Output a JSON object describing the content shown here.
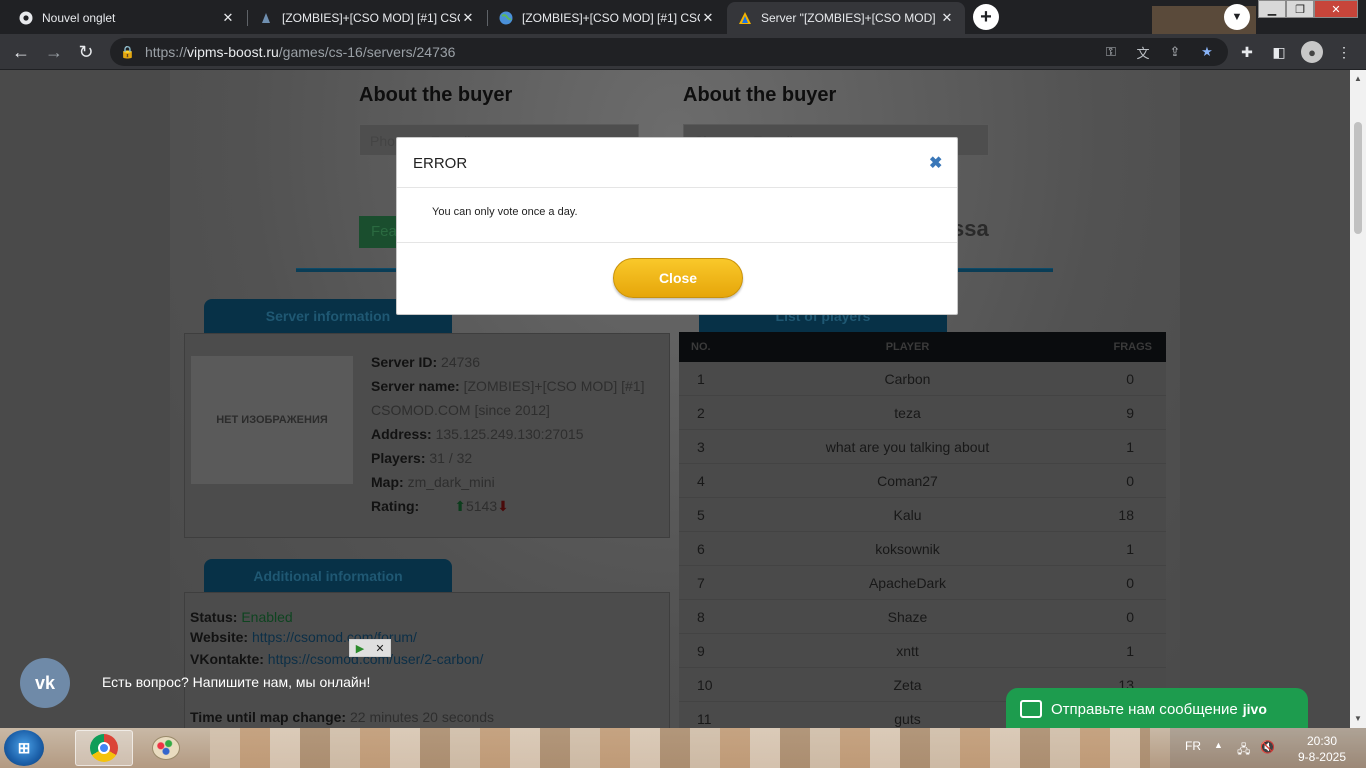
{
  "browser": {
    "tabs": [
      {
        "title": "Nouvel onglet",
        "icon": "chrome-icon",
        "active": false
      },
      {
        "title": "[ZOMBIES]+[CSO MOD] [#1] CSO",
        "icon": "cs-icon",
        "active": false
      },
      {
        "title": "[ZOMBIES]+[CSO MOD] [#1] CSO",
        "icon": "globe-icon",
        "active": false
      },
      {
        "title": "Server \"[ZOMBIES]+[CSO MOD] [",
        "icon": "warning-triangle-icon",
        "active": true
      }
    ],
    "url_prefix": "https://",
    "url_domain": "vipms-boost.ru",
    "url_path": "/games/cs-16/servers/24736"
  },
  "page": {
    "buyer_heading_left": "About the buyer",
    "buyer_heading_right": "About the buyer",
    "input_left_placeholder": "Phone or E-mail",
    "input_right_placeholder": "Skype or E-mail",
    "green_button": "Fea",
    "partial_text": "ssa",
    "server_info_tab": "Server information",
    "players_tab": "List of players",
    "no_image": "НЕТ ИЗОБРАЖЕНИЯ",
    "server": {
      "id_label": "Server ID:",
      "id_value": "24736",
      "name_label": "Server name:",
      "name_value": "[ZOMBIES]+[CSO MOD] [#1]",
      "name_value2": "CSOMOD.COM [since 2012]",
      "address_label": "Address:",
      "address_value": "135.125.249.130:27015",
      "players_label": "Players:",
      "players_value": "31 / 32",
      "map_label": "Map:",
      "map_value": "zm_dark_mini",
      "rating_label": "Rating:",
      "rating_value": "5143"
    },
    "additional_tab": "Additional information",
    "additional": {
      "status_label": "Status:",
      "status_value": "Enabled",
      "website_label": "Website:",
      "website_value": "https://csomod.com/forum/",
      "vk_label": "VKontakte:",
      "vk_value": "https://csomod.com/user/2-carbon/",
      "map_change_label": "Time until map change:",
      "map_change_value": "22 minutes 20 seconds"
    },
    "players_table": {
      "headers": {
        "no": "NO.",
        "player": "PLAYER",
        "frags": "FRAGS"
      },
      "rows": [
        {
          "no": "1",
          "player": "Carbon",
          "frags": "0"
        },
        {
          "no": "2",
          "player": "teza",
          "frags": "9"
        },
        {
          "no": "3",
          "player": "what are you talking about",
          "frags": "1"
        },
        {
          "no": "4",
          "player": "Coman27",
          "frags": "0"
        },
        {
          "no": "5",
          "player": "Kalu",
          "frags": "18"
        },
        {
          "no": "6",
          "player": "koksownik",
          "frags": "1"
        },
        {
          "no": "7",
          "player": "ApacheDark",
          "frags": "0"
        },
        {
          "no": "8",
          "player": "Shaze",
          "frags": "0"
        },
        {
          "no": "9",
          "player": "xntt",
          "frags": "1"
        },
        {
          "no": "10",
          "player": "Zeta",
          "frags": "13"
        },
        {
          "no": "11",
          "player": "guts",
          "frags": ""
        }
      ]
    }
  },
  "modal": {
    "title": "ERROR",
    "message": "You can only vote once a day.",
    "button": "Close"
  },
  "widgets": {
    "vk_text": "Есть вопрос? Напишите нам, мы онлайн!",
    "jivo_text": "Отправьте нам сообщение",
    "jivo_brand": "jivo"
  },
  "taskbar": {
    "lang": "FR",
    "time": "20:30",
    "date": "9-8-2025"
  }
}
